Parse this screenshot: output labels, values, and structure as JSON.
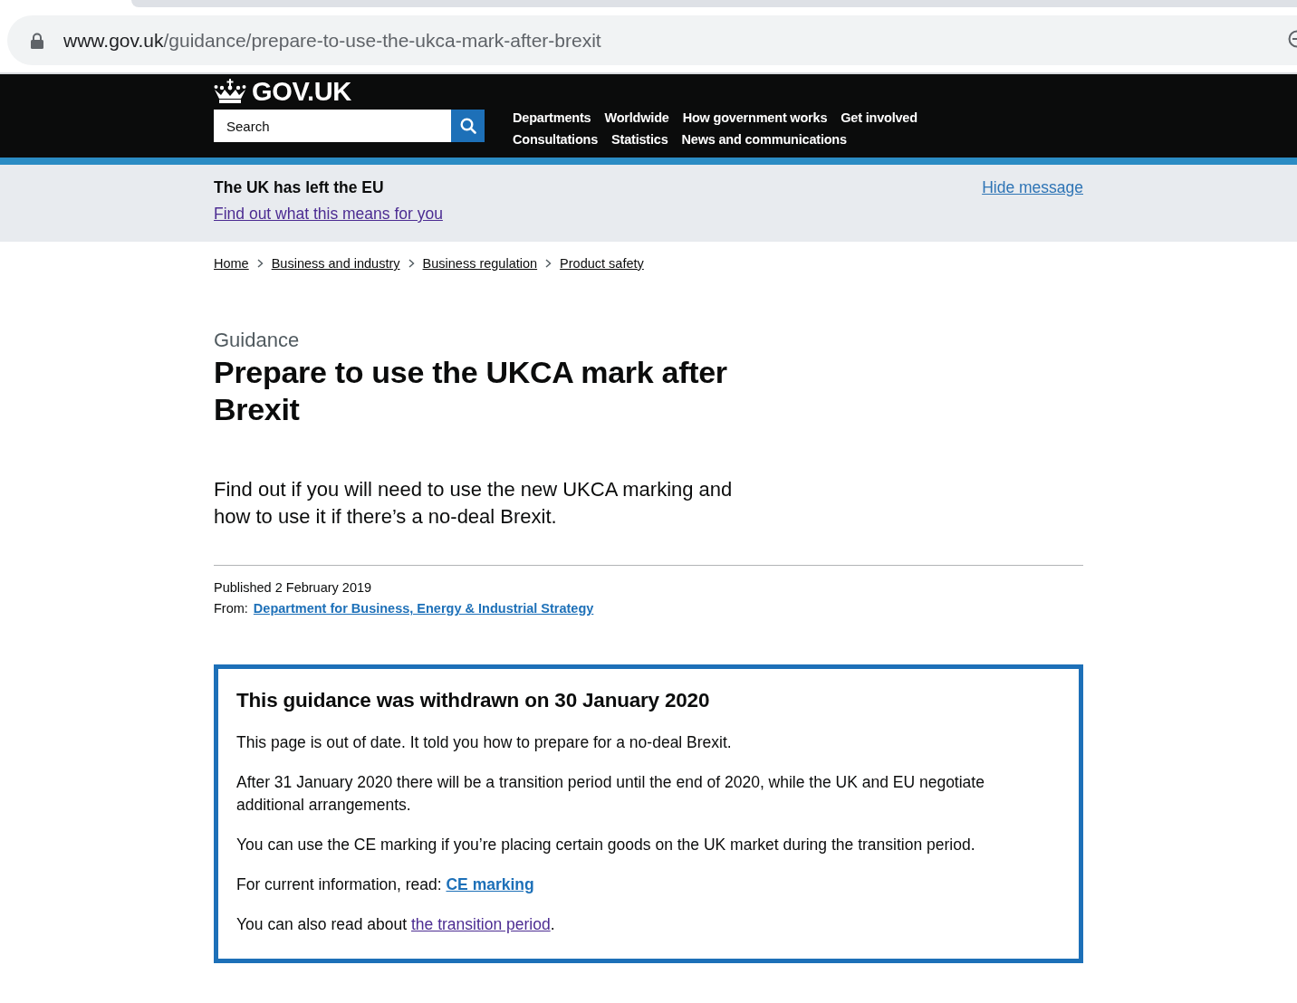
{
  "browser": {
    "address_bar": {
      "host": "www.gov.uk",
      "path": "/guidance/prepare-to-use-the-ukca-mark-after-brexit"
    }
  },
  "header": {
    "logo": "GOV.UK",
    "search": {
      "placeholder": "Search"
    },
    "nav_rows": [
      {
        "items": [
          "Departments",
          "Worldwide",
          "How government works",
          "Get involved"
        ]
      },
      {
        "items": [
          "Consultations",
          "Statistics",
          "News and communications"
        ]
      }
    ]
  },
  "banner": {
    "title": "The UK has left the EU",
    "link": {
      "text": "Find out what this means for you",
      "visited": true
    },
    "hide": "Hide message"
  },
  "breadcrumbs": [
    "Home",
    "Business and industry",
    "Business regulation",
    "Product safety"
  ],
  "page": {
    "document_type": "Guidance",
    "title": "Prepare to use the UKCA mark after Brexit",
    "lead": "Find out if you will need to use the new UKCA marking and how to use it if there’s a no-deal Brexit."
  },
  "metadata": {
    "published": "Published 2 February 2019",
    "from_label": "From:",
    "from_link": "Department for Business, Energy & Industrial Strategy"
  },
  "withdrawn_notice": {
    "title": "This guidance was withdrawn on 30 January 2020",
    "paragraphs": [
      [
        {
          "kind": "text",
          "text": "This page is out of date. It told you how to prepare for a no-deal Brexit."
        }
      ],
      [
        {
          "kind": "text",
          "text": "After 31 January 2020 there will be a transition period until the end of 2020, while the UK and EU negotiate additional arrangements."
        }
      ],
      [
        {
          "kind": "text",
          "text": "You can use the CE marking if you’re placing certain goods on the UK market during the transition period."
        }
      ],
      [
        {
          "kind": "text",
          "text": "For current information, read: "
        },
        {
          "kind": "bold_link",
          "text": "CE marking",
          "visited": false
        }
      ],
      [
        {
          "kind": "text",
          "text": "You can also read about "
        },
        {
          "kind": "link",
          "text": "the transition period",
          "visited": true
        },
        {
          "kind": "text",
          "text": "."
        }
      ]
    ]
  }
}
